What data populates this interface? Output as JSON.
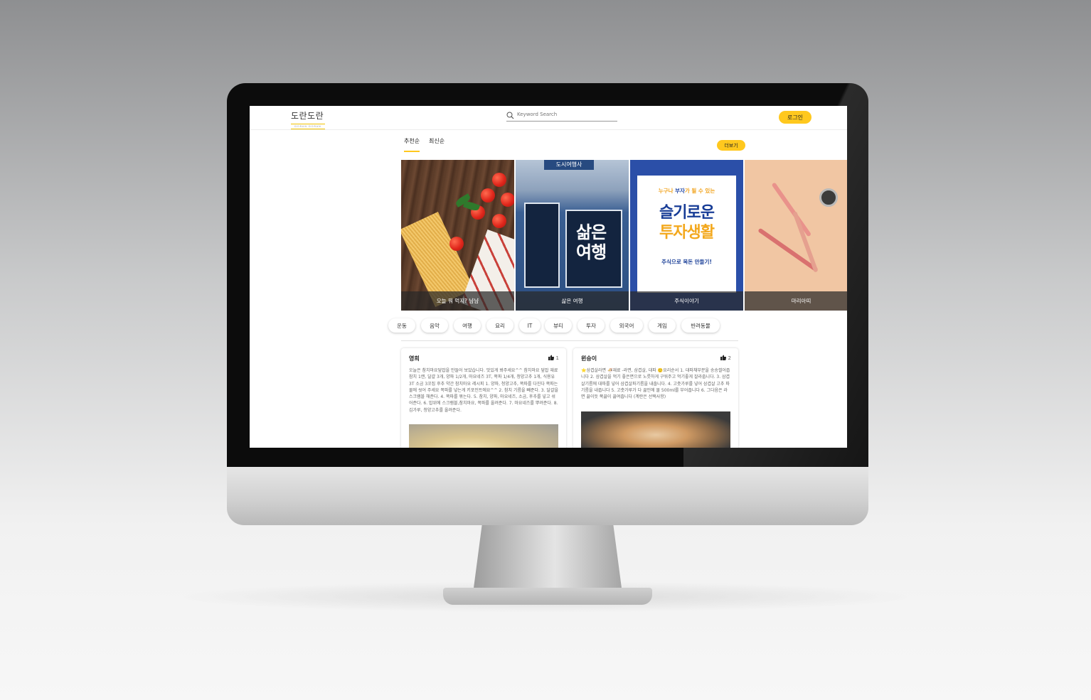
{
  "colors": {
    "accent": "#ffc81e",
    "invest_blue": "#173c96",
    "invest_orange": "#f3a81d"
  },
  "header": {
    "logo_ko": "도란도란",
    "logo_en": "DORAN DORAN",
    "search_placeholder": "Keyword Search",
    "login_label": "로그인"
  },
  "tabs": [
    {
      "label": "추천순",
      "active": true
    },
    {
      "label": "최신순",
      "active": false
    }
  ],
  "more_label": "더보기",
  "cards": [
    {
      "caption": "오늘 뭐 먹지? 냠냠"
    },
    {
      "caption": "삶은 여행",
      "image_text": "삶은\n여행",
      "sign_text": "도시여행사"
    },
    {
      "caption": "주식이야기",
      "image_text_1a": "누구나 ",
      "image_text_1b": "부자",
      "image_text_1c": "가 될 수 있는",
      "image_text_2": "슬기로운",
      "image_text_3": "투자생활",
      "image_text_4": "주식으로 목돈 만들기!"
    },
    {
      "caption": "마리아띠"
    }
  ],
  "categories": [
    "운동",
    "음악",
    "여행",
    "요리",
    "IT",
    "뷰티",
    "투자",
    "외국어",
    "게임",
    "반려동물"
  ],
  "posts": [
    {
      "author": "영희",
      "likes": "1",
      "body": "오늘은 참치마요덮밥을 만들어 보았습니다. 맛있게 봐주세요^^ 참치마요 덮밥 재료 참치 1캔, 달걀 3개, 양파 1/2개, 마요네즈 3T, 쪽파 1/4개, 청양고추 1개, 식용유 3T 소금 3꼬집 후추 약간 참치마요 레시피 1. 양파, 청양고추, 쪽파를 다진다 쪽파는 물에 씻어 주세요 쪽파를 넣는게 키포인트에요^^ 2. 참치 기름을 빼준다. 3. 달걀을 스크램블 해준다. 4. 쪽파를 볶는다. 5. 참치, 양파, 마요네즈, 소금, 후추를 넣고 섞어준다. 6. 밥위에 스크램블,참치마요, 쪽파를 올려준다. 7. 마요네즈를 뿌려준다. 8. 김가루, 청양고추를 올려준다."
    },
    {
      "author": "윈승이",
      "likes": "2",
      "body": "⭐삼겹살라면 🍜재료 -라면, 삼겹살, 대파 🙂요리순서 1. 대파채부분을 송송썰어줍니다 2. 삼겹살을 먹기 좋은면으로 노릇하게 구워주고 먹기좋게 잘라줍니다. 3. 삼겹살기름에 대파를 넣어 삼겹살파기름을 내줍니다. 4. 고춧가루를 넣어 삼겹살 고추 파기름을 내줍니다 5. 고춧가루가 다 끓인에 물 500ml를 부어줍니다 6. 그다음은 라면 끓이듯 쭉끓이 끓여줍니다 (계란은 선택사항)"
    }
  ]
}
